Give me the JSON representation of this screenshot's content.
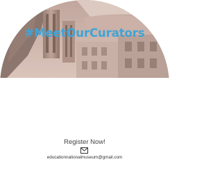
{
  "badge": {
    "headline": "#MeetOurCurators",
    "cta": "Register Now!",
    "email": "educationnationalmuseum@gmail.com",
    "icon": "envelope-icon"
  },
  "colors": {
    "headline": "#3ea4d9",
    "photo_tint": "#c9a99e",
    "background": "#ffffff",
    "text": "#444444"
  }
}
